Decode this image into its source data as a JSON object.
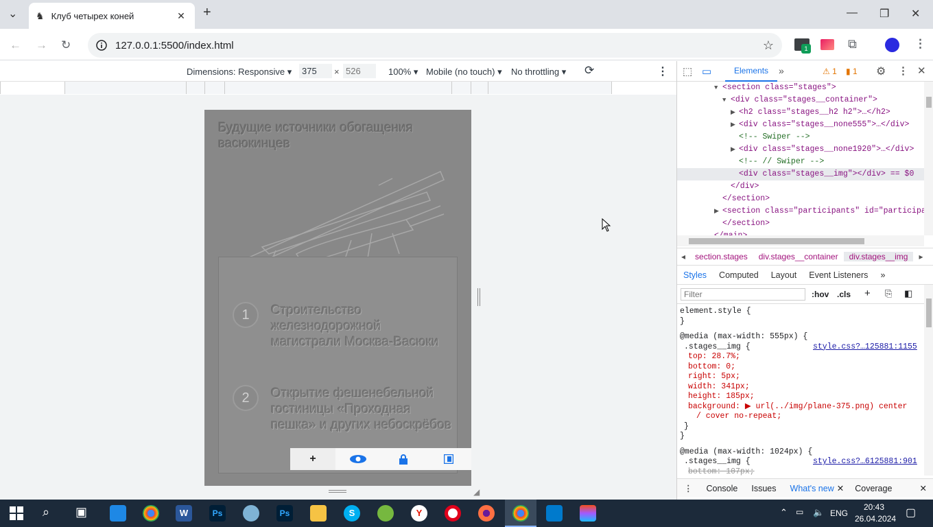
{
  "browser": {
    "tab_title": "Клуб четырех коней",
    "url": "127.0.0.1:5500/index.html"
  },
  "device_toolbar": {
    "dimensions_label": "Dimensions: Responsive",
    "width": "375",
    "height": "526",
    "zoom": "100%",
    "device_mode": "Mobile (no touch)",
    "throttling": "No throttling"
  },
  "page": {
    "stages_title": "Будущие источники обогащения васюкинцев",
    "stages": [
      {
        "num": "1",
        "text": "Строительство железнодорожной магистрали Москва-Васюки"
      },
      {
        "num": "2",
        "text": "Открытие фешенебельной гостиницы «Проходная пешка» и других небоскрёбов"
      }
    ],
    "ext_bar_plus": "+"
  },
  "devtools": {
    "tabs": {
      "elements": "Elements",
      "more": "»"
    },
    "warnings": "1",
    "issues": "1",
    "tree": [
      {
        "indent": 4,
        "html": "<section class=\"stages\">",
        "arrow": "▼"
      },
      {
        "indent": 5,
        "html": "<div class=\"stages__container\">",
        "arrow": "▼"
      },
      {
        "indent": 6,
        "html": "<h2 class=\"stages__h2 h2\">…</h2>",
        "arrow": "▶"
      },
      {
        "indent": 6,
        "html": "<div class=\"stages__none555\">…</div>",
        "arrow": "▶"
      },
      {
        "indent": 6,
        "html": "<!-- Swiper -->",
        "arrow": ""
      },
      {
        "indent": 6,
        "html": "<div class=\"stages__none1920\">…</div>",
        "arrow": "▶"
      },
      {
        "indent": 6,
        "html": "<!-- // Swiper -->",
        "arrow": ""
      },
      {
        "indent": 6,
        "html": "<div class=\"stages__img\"></div> == $0",
        "arrow": ""
      },
      {
        "indent": 5,
        "html": "</div>",
        "arrow": ""
      },
      {
        "indent": 4,
        "html": "</section>",
        "arrow": ""
      },
      {
        "indent": 4,
        "html": "<section class=\"participants\" id=\"participa",
        "arrow": "▶"
      },
      {
        "indent": 4,
        "html": "</section>",
        "arrow": ""
      },
      {
        "indent": 3,
        "html": "</main>",
        "arrow": ""
      }
    ],
    "breadcrumb": [
      "section.stages",
      "div.stages__container",
      "div.stages__img"
    ],
    "style_tabs": [
      "Styles",
      "Computed",
      "Layout",
      "Event Listeners",
      "»"
    ],
    "filter_placeholder": "Filter",
    "hov": ":hov",
    "cls": ".cls",
    "styles": [
      "element.style {",
      "}",
      "@media (max-width: 555px) {",
      ".stages__img {",
      "top: 28.7%;",
      "bottom: 0;",
      "right: 5px;",
      "width: 341px;",
      "height: 185px;",
      "background: ▶ url(../img/plane-375.png) center",
      "/ cover no-repeat;",
      "}",
      "}",
      "@media (max-width: 1024px) {",
      ".stages__img {",
      "bottom: 107px;"
    ],
    "style_src_1": "style.css?…125881:1155",
    "style_src_2": "style.css?…6125881:901",
    "drawer": [
      "Console",
      "Issues",
      "What's new",
      "Coverage"
    ]
  },
  "taskbar": {
    "lang": "ENG",
    "time": "20:43",
    "date": "26.04.2024"
  }
}
